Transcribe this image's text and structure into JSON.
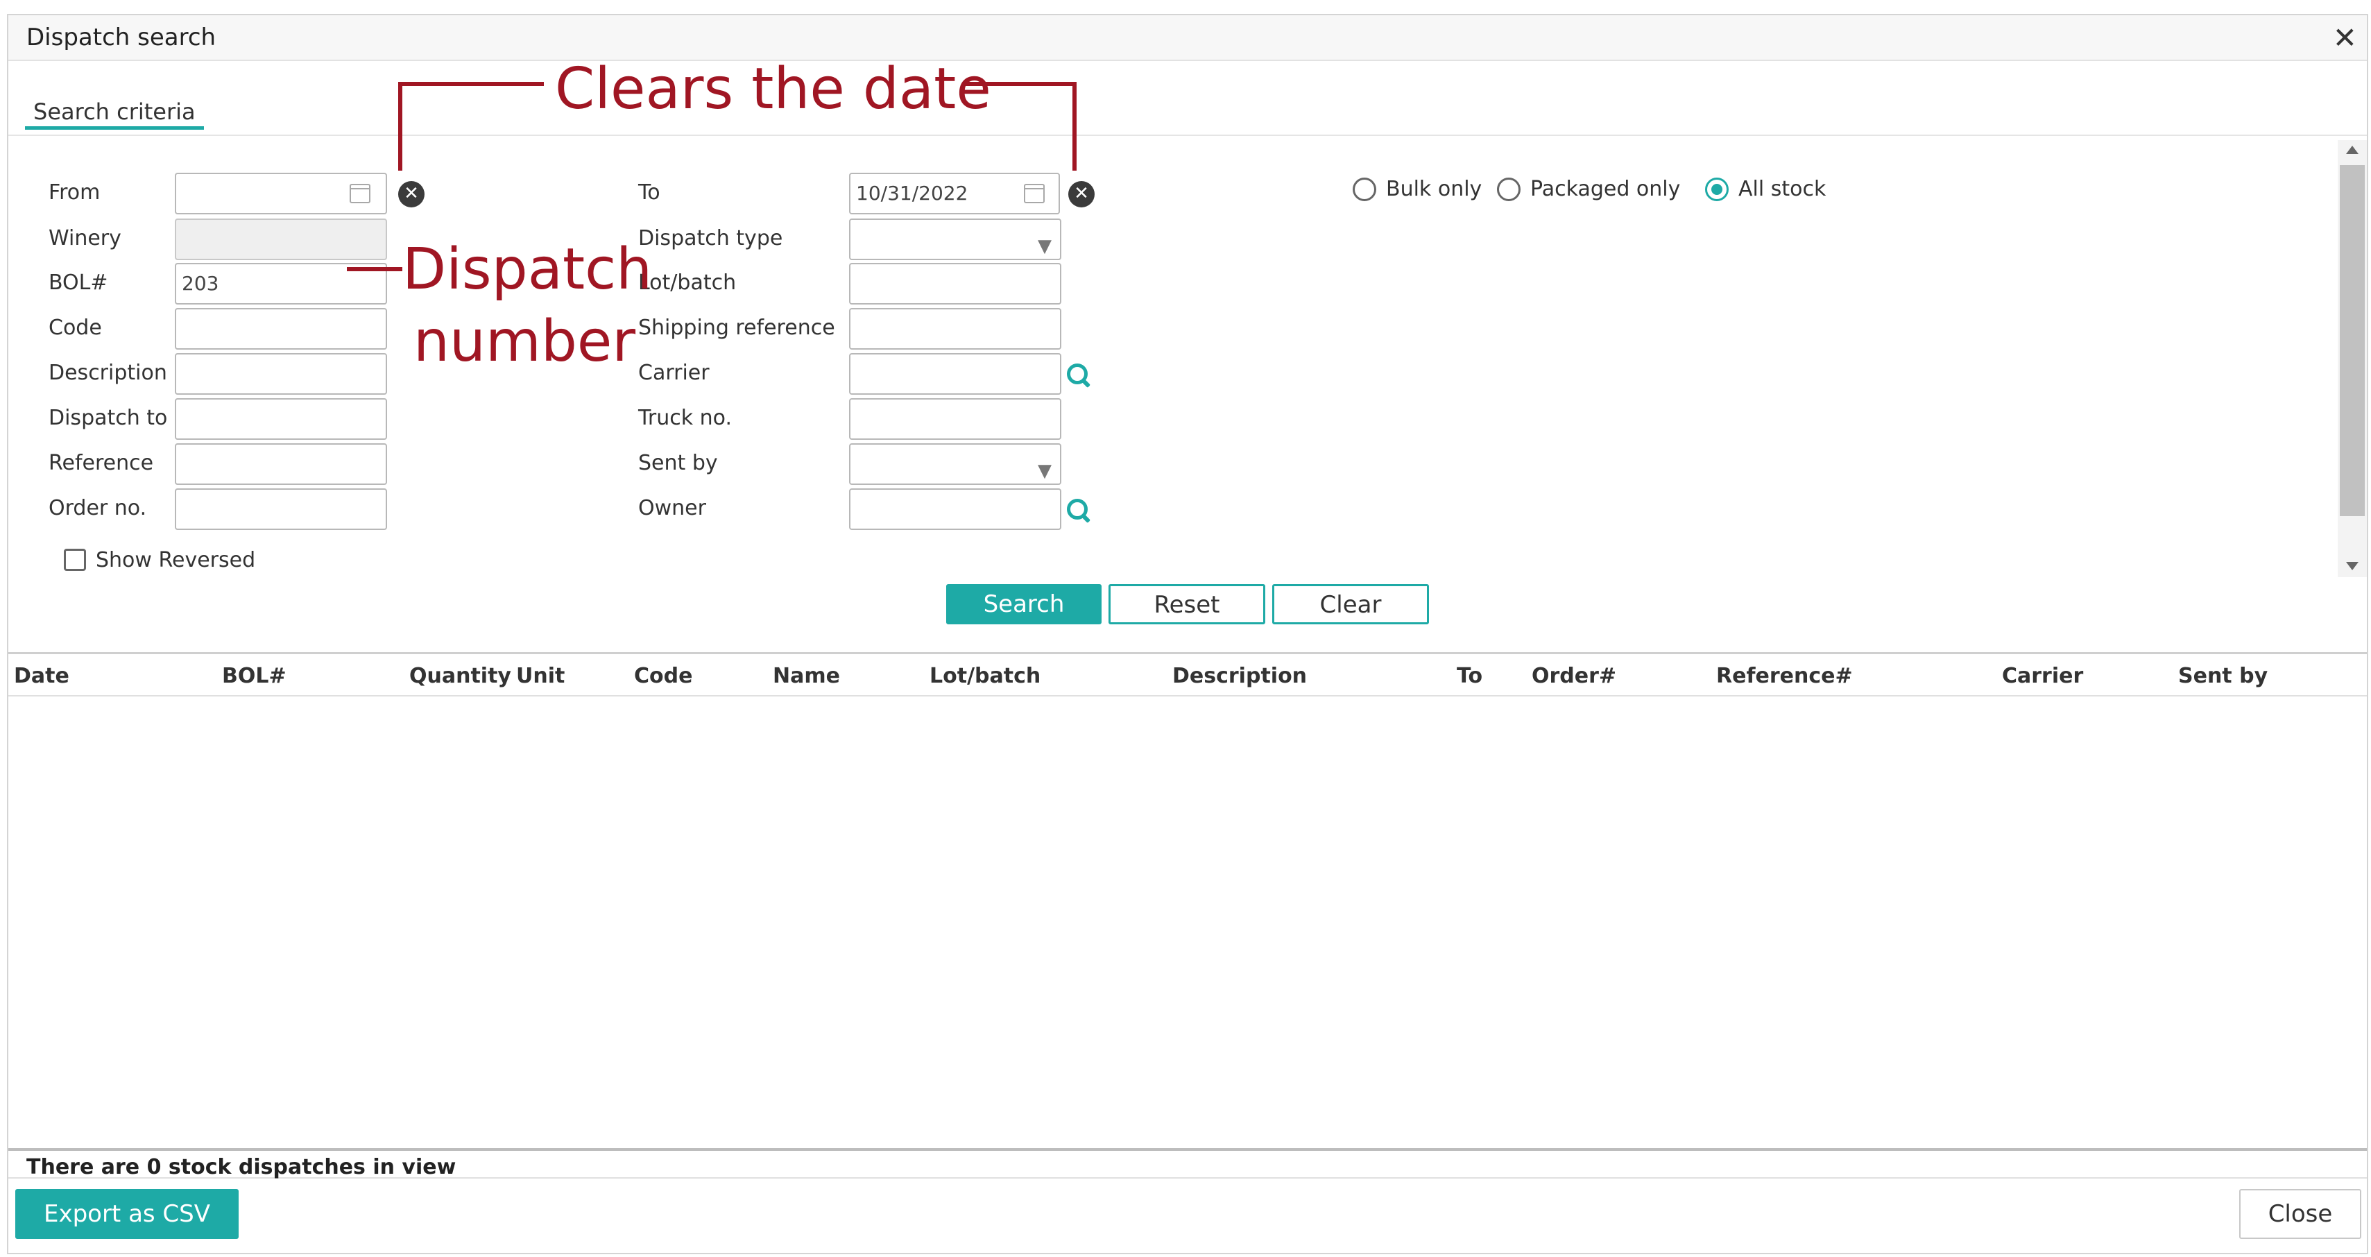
{
  "dialog": {
    "title": "Dispatch search"
  },
  "tabs": [
    {
      "label": "Search criteria"
    }
  ],
  "left_fields": [
    {
      "label": "From",
      "value": ""
    },
    {
      "label": "Winery",
      "value": ""
    },
    {
      "label": "BOL#",
      "value": "203"
    },
    {
      "label": "Code",
      "value": ""
    },
    {
      "label": "Description",
      "value": ""
    },
    {
      "label": "Dispatch to",
      "value": ""
    },
    {
      "label": "Reference",
      "value": ""
    },
    {
      "label": "Order no.",
      "value": ""
    }
  ],
  "right_fields": [
    {
      "label": "To",
      "value": "10/31/2022"
    },
    {
      "label": "Dispatch type",
      "value": ""
    },
    {
      "label": "Lot/batch",
      "value": ""
    },
    {
      "label": "Shipping reference",
      "value": ""
    },
    {
      "label": "Carrier",
      "value": ""
    },
    {
      "label": "Truck no.",
      "value": ""
    },
    {
      "label": "Sent by",
      "value": ""
    },
    {
      "label": "Owner",
      "value": ""
    }
  ],
  "stock_filter": {
    "options": [
      "Bulk only",
      "Packaged only",
      "All stock"
    ],
    "selected": "All stock"
  },
  "show_reversed": {
    "label": "Show Reversed",
    "checked": false
  },
  "buttons": {
    "search": "Search",
    "reset": "Reset",
    "clear": "Clear"
  },
  "columns": [
    "Date",
    "BOL#",
    "Quantity",
    "Unit",
    "Code",
    "Name",
    "Lot/batch",
    "Description",
    "To",
    "Order#",
    "Reference#",
    "Carrier",
    "Sent by"
  ],
  "status": "There are 0 stock dispatches in view",
  "footer": {
    "export": "Export as CSV",
    "close": "Close"
  },
  "annotations": {
    "clears_date": "Clears the date",
    "dispatch_line1": "Dispatch",
    "dispatch_line2": "number"
  },
  "colors": {
    "accent": "#1eaaa6",
    "annotation": "#a01623"
  },
  "icons": {
    "calendar": "calendar-icon",
    "clear": "clear-date-icon",
    "search": "search-icon",
    "close": "close-icon"
  }
}
